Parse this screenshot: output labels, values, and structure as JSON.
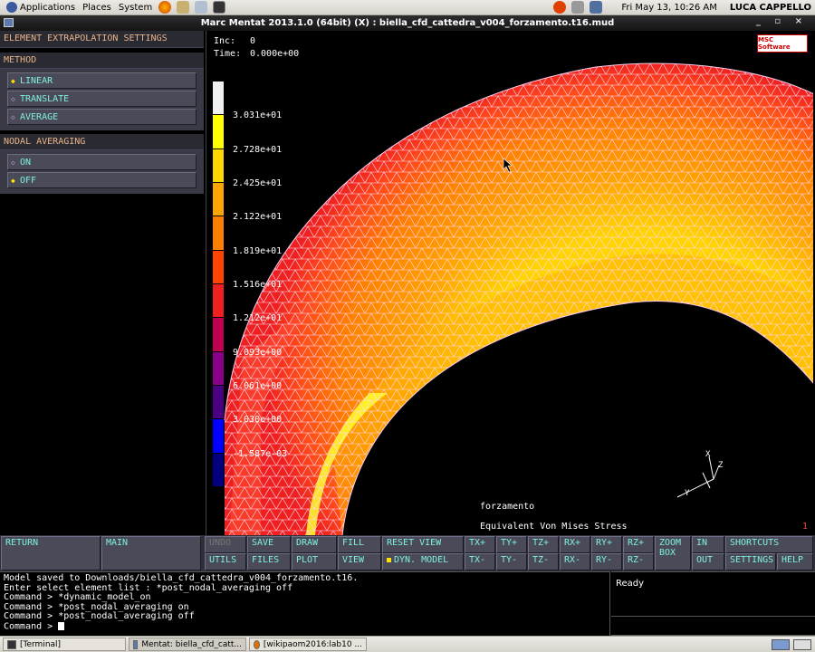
{
  "topbar": {
    "menus": [
      "Applications",
      "Places",
      "System"
    ],
    "clock": "Fri May 13, 10:26 AM",
    "user": "LUCA CAPPELLO"
  },
  "window": {
    "title": "Marc Mentat 2013.1.0 (64bit) (X) : biella_cfd_cattedra_v004_forzamento.t16.mud",
    "controls": "_ ▫ ×"
  },
  "left_panel": {
    "title": "ELEMENT EXTRAPOLATION SETTINGS",
    "method_header": "METHOD",
    "method_options": [
      "LINEAR",
      "TRANSLATE",
      "AVERAGE"
    ],
    "method_selected": "LINEAR",
    "nodal_header": "NODAL AVERAGING",
    "nodal_options": [
      "ON",
      "OFF"
    ],
    "nodal_selected": "OFF"
  },
  "viewport": {
    "inc_label": "Inc:",
    "inc_value": "0",
    "time_label": "Time:",
    "time_value": "0.000e+00",
    "badge": "MSC Software",
    "legend_labels": [
      "3.031e+01",
      "2.728e+01",
      "2.425e+01",
      "2.122e+01",
      "1.819e+01",
      "1.516e+01",
      "1.212e+01",
      "9.093e+00",
      "6.061e+00",
      "3.030e+00",
      "-1.587e-03"
    ],
    "legend_colors": [
      "#f0f0f0",
      "#ffff00",
      "#ffd700",
      "#ffa500",
      "#ff7f00",
      "#ff4500",
      "#ee2020",
      "#c00050",
      "#8b008b",
      "#4b0082",
      "#0000ff",
      "#00007f"
    ],
    "caption_job": "forzamento",
    "caption_quantity": "Equivalent Von Mises Stress",
    "page_number": "1",
    "axis_labels": [
      "X",
      "Y",
      "Z"
    ]
  },
  "bottom_buttons": {
    "return": "RETURN",
    "main": "MAIN",
    "undo": "UNDO",
    "save": "SAVE",
    "draw": "DRAW",
    "fill": "FILL",
    "reset_view": "RESET VIEW",
    "txp": "TX+",
    "typ": "TY+",
    "tzp": "TZ+",
    "rxp": "RX+",
    "ryp": "RY+",
    "rzp": "RZ+",
    "zoom_box": "ZOOM BOX",
    "in": "IN",
    "shortcuts": "SHORTCUTS",
    "utils": "UTILS",
    "files": "FILES",
    "plot": "PLOT",
    "view": "VIEW",
    "dyn_model": "DYN. MODEL",
    "txm": "TX-",
    "tym": "TY-",
    "tzm": "TZ-",
    "rxm": "RX-",
    "rym": "RY-",
    "rzm": "RZ-",
    "out": "OUT",
    "settings": "SETTINGS",
    "help": "HELP"
  },
  "console": {
    "lines": [
      "Model saved to Downloads/biella_cfd_cattedra_v004_forzamento.t16.",
      "Enter select element list : *post_nodal_averaging off",
      "Command > *dynamic_model_on",
      "Command > *post_nodal_averaging on",
      "Command > *post_nodal_averaging off"
    ],
    "prompt": "Command > ",
    "status": "Ready"
  },
  "taskbar": {
    "tasks": [
      "[Terminal]",
      "Mentat: biella_cfd_catt...",
      "[wikipaom2016:lab10 ..."
    ]
  }
}
